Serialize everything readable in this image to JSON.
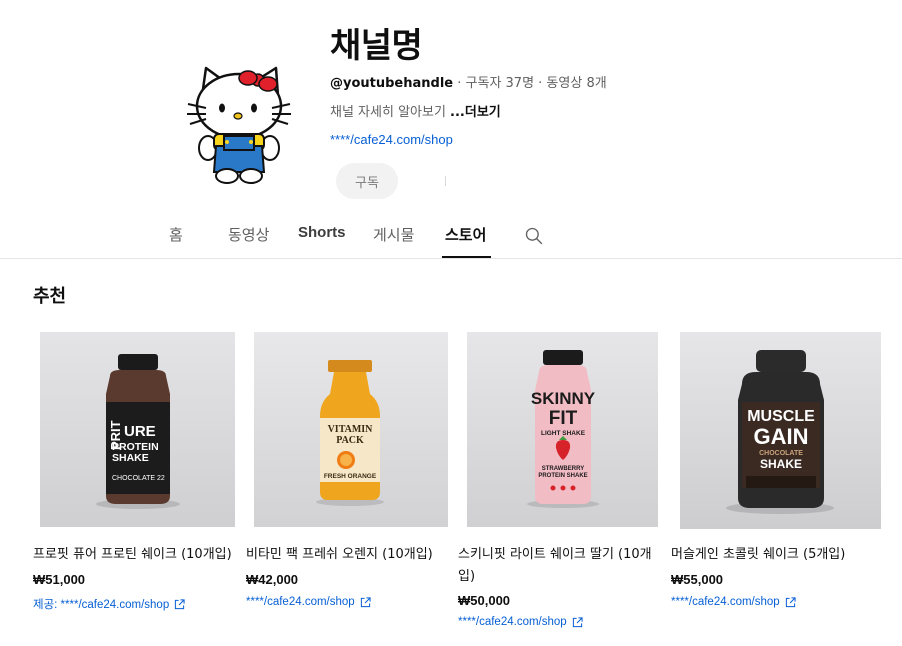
{
  "channel": {
    "name": "채널명",
    "handle": "@youtubehandle",
    "stats": " · 구독자 37명 · 동영상 8개",
    "description": "채널 자세히 알아보기 ",
    "more_label": "...더보기",
    "link": "****/cafe24.com/shop",
    "subscribe_label": "구독"
  },
  "tabs": [
    {
      "label": "홈"
    },
    {
      "label": "동영상"
    },
    {
      "label": "Shorts"
    },
    {
      "label": "게시물"
    },
    {
      "label": "스토어"
    }
  ],
  "active_tab": "스토어",
  "section": {
    "title": "추천"
  },
  "products": [
    {
      "title": "프로핏 퓨어 프로틴 쉐이크 (10개입)",
      "price": "₩51,000",
      "link": "제공: ****/cafe24.com/shop",
      "bottle_label_lines": [
        "PRIT",
        "URE",
        "PROTEIN",
        "SHAKE",
        "CHOCOLATE  22"
      ],
      "bottle_color": "#5a3a2e"
    },
    {
      "title": "비타민 팩 프레쉬 오렌지 (10개입)",
      "price": "₩42,000",
      "link": "****/cafe24.com/shop",
      "bottle_label_lines": [
        "VITAMIN",
        "PACK",
        "FRESH ORANGE"
      ],
      "bottle_color": "#f0a51e"
    },
    {
      "title": "스키니핏 라이트 쉐이크 딸기 (10개입)",
      "price": "₩50,000",
      "link": "****/cafe24.com/shop",
      "bottle_label_lines": [
        "SKINNY",
        "FIT",
        "LIGHT SHAKE",
        "STRAWBERRY",
        "PROTEIN SHAKE"
      ],
      "bottle_color": "#f2bcc4"
    },
    {
      "title": "머슬게인 초콜릿 쉐이크 (5개입)",
      "price": "₩55,000",
      "link": "****/cafe24.com/shop",
      "bottle_label_lines": [
        "MUSCLE",
        "GAIN",
        "CHOCOLATE",
        "SHAKE"
      ],
      "bottle_color": "#2a2a2a"
    }
  ],
  "colors": {
    "link": "#065fd4",
    "text": "#0f0f0f",
    "muted": "#606060"
  }
}
